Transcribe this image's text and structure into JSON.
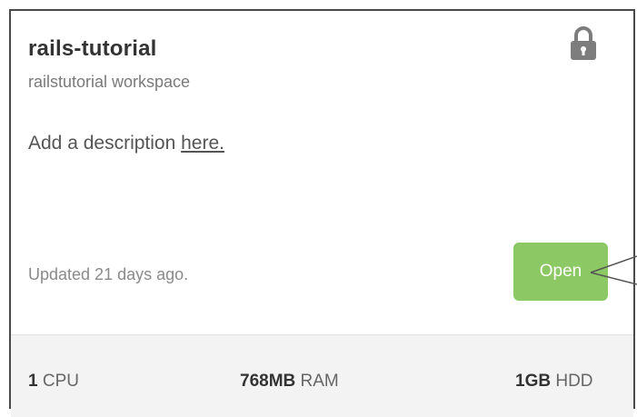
{
  "workspace": {
    "name": "rails-tutorial",
    "subtitle": "railstutorial workspace",
    "description_prefix": "Add a description ",
    "description_link": "here.",
    "updated": "Updated 21 days ago.",
    "open_label": "Open",
    "lock_icon": "lock-icon"
  },
  "resources": {
    "cpu_value": "1",
    "cpu_unit": "CPU",
    "ram_value": "768MB",
    "ram_unit": "RAM",
    "hdd_value": "1GB",
    "hdd_unit": "HDD"
  },
  "colors": {
    "open_button": "#8cc964",
    "footer_bg": "#f3f3f3",
    "border": "#4a4a4a"
  }
}
